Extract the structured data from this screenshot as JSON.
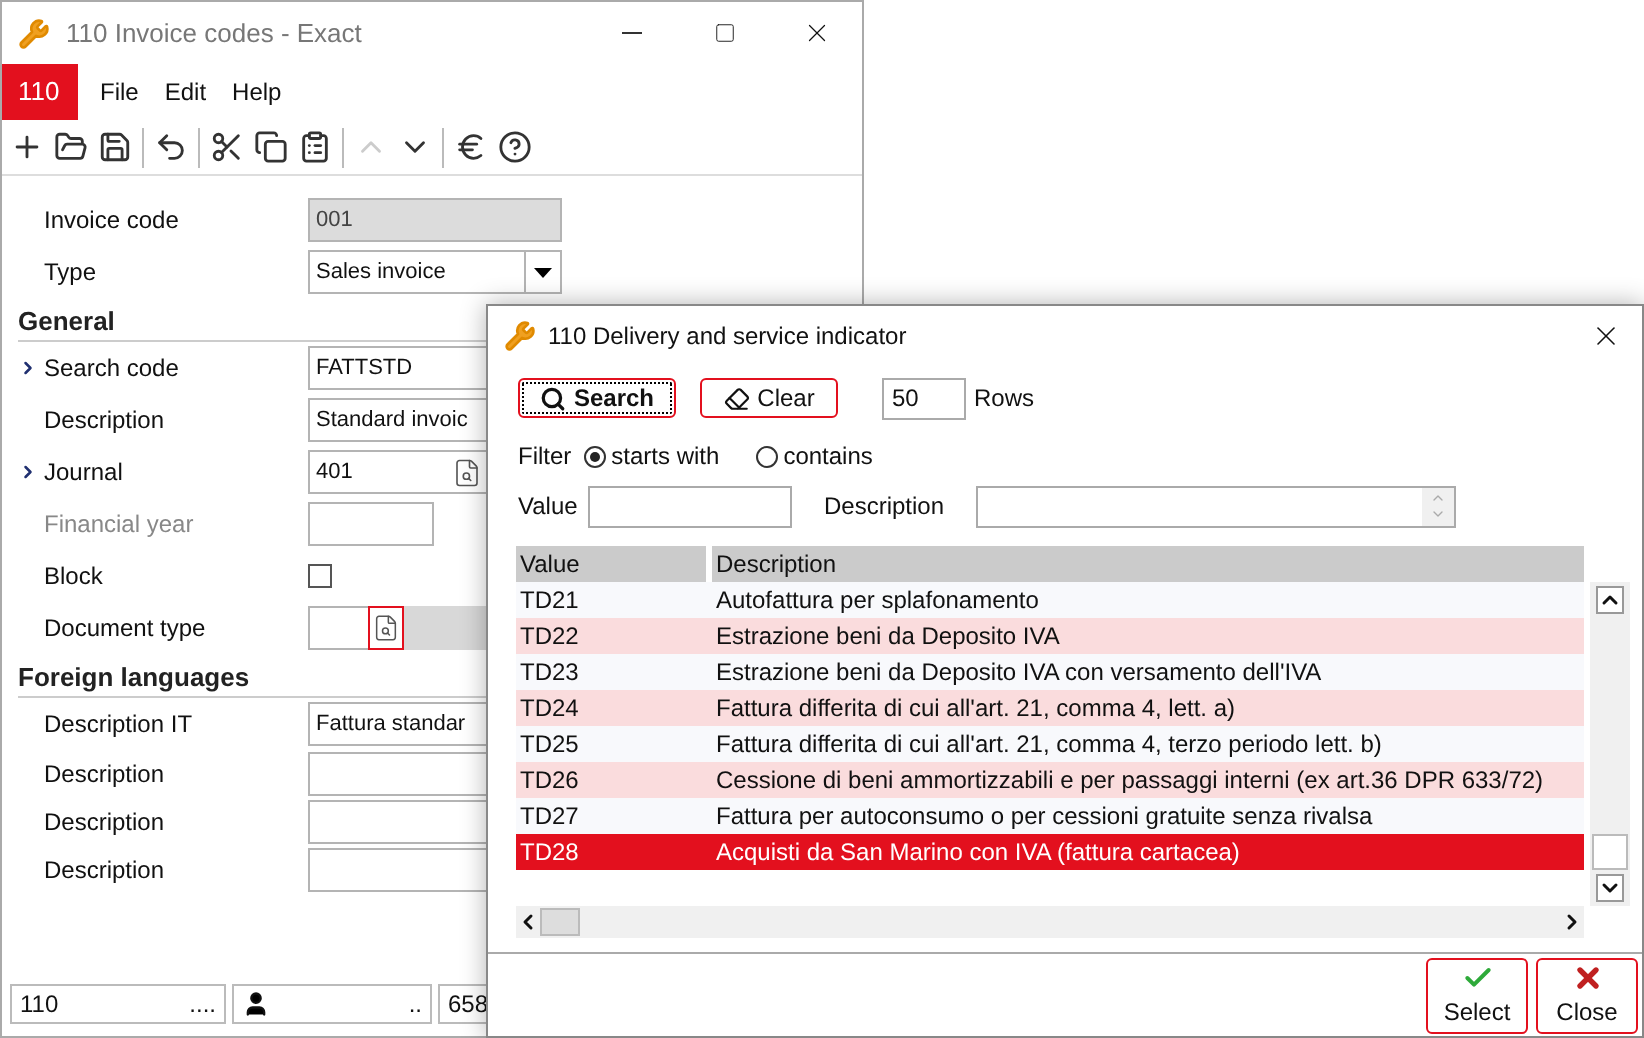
{
  "main_window": {
    "title": "110 Invoice codes - Exact",
    "badge": "110",
    "menu": [
      "File",
      "Edit",
      "Help"
    ],
    "toolbar": [
      {
        "kind": "add",
        "disabled": false
      },
      {
        "kind": "open",
        "disabled": false
      },
      {
        "kind": "save",
        "disabled": false
      },
      {
        "kind": "sep"
      },
      {
        "kind": "undo",
        "disabled": false
      },
      {
        "kind": "sep"
      },
      {
        "kind": "cut",
        "disabled": false
      },
      {
        "kind": "copy",
        "disabled": false
      },
      {
        "kind": "paste",
        "disabled": false
      },
      {
        "kind": "sep"
      },
      {
        "kind": "up",
        "disabled": true
      },
      {
        "kind": "down",
        "disabled": false
      },
      {
        "kind": "sep"
      },
      {
        "kind": "euro",
        "disabled": false
      },
      {
        "kind": "help",
        "disabled": false
      }
    ],
    "form": [
      {
        "kind": "readonly",
        "label": "Invoice code",
        "value": "001",
        "linked": false,
        "disabled": false
      },
      {
        "kind": "select",
        "label": "Type",
        "value": "Sales invoice",
        "linked": false,
        "disabled": false
      },
      {
        "kind": "section",
        "label": "General"
      },
      {
        "kind": "text",
        "label": "Search code",
        "value": "FATTSTD",
        "linked": true,
        "disabled": false
      },
      {
        "kind": "text",
        "label": "Description",
        "value": "Standard invoic",
        "linked": false,
        "disabled": false
      },
      {
        "kind": "lookup",
        "label": "Journal",
        "value": "401",
        "linked": true,
        "disabled": false
      },
      {
        "kind": "short",
        "label": "Financial year",
        "linked": false,
        "disabled": true
      },
      {
        "kind": "checkbox",
        "label": "Block",
        "checked": false,
        "linked": false,
        "disabled": false
      },
      {
        "kind": "doclookup",
        "label": "Document type",
        "linked": false,
        "disabled": false
      },
      {
        "kind": "section",
        "label": "Foreign languages"
      },
      {
        "kind": "text",
        "label": "Description IT",
        "value": "Fattura standar",
        "linked": false,
        "disabled": false
      },
      {
        "kind": "text",
        "label": "Description",
        "linked": false,
        "disabled": false
      },
      {
        "kind": "text",
        "label": "Description",
        "linked": false,
        "disabled": false
      },
      {
        "kind": "text",
        "label": "Description",
        "linked": false,
        "disabled": false
      }
    ],
    "status_bar": [
      {
        "kind": "text",
        "text": "110",
        "trail": "...."
      },
      {
        "kind": "user",
        "trail": ".."
      },
      {
        "kind": "text",
        "text": "658"
      }
    ]
  },
  "dialog": {
    "title": "110 Delivery and service indicator",
    "search_label": "Search",
    "clear_label": "Clear",
    "rows_value": "50",
    "rows_label": "Rows",
    "filter_label": "Filter",
    "filter_options": [
      {
        "label": "starts with",
        "selected": true
      },
      {
        "label": "contains",
        "selected": false
      }
    ],
    "value_label": "Value",
    "description_label": "Description",
    "columns": [
      "Value",
      "Description"
    ],
    "rows": [
      {
        "value": "TD21",
        "description": "Autofattura per splafonamento",
        "selected": false
      },
      {
        "value": "TD22",
        "description": "Estrazione beni da Deposito IVA",
        "selected": false
      },
      {
        "value": "TD23",
        "description": "Estrazione beni da Deposito IVA con versamento dell'IVA",
        "selected": false
      },
      {
        "value": "TD24",
        "description": "Fattura differita di cui all'art. 21, comma 4, lett. a)",
        "selected": false
      },
      {
        "value": "TD25",
        "description": "Fattura differita di cui all'art. 21, comma 4, terzo periodo lett. b)",
        "selected": false
      },
      {
        "value": "TD26",
        "description": "Cessione di beni ammortizzabili e per passaggi interni (ex art.36 DPR 633/72)",
        "selected": false
      },
      {
        "value": "TD27",
        "description": "Fattura per autoconsumo o per cessioni gratuite senza rivalsa",
        "selected": false
      },
      {
        "value": "TD28",
        "description": "Acquisti da San Marino con IVA (fattura cartacea)",
        "selected": true
      }
    ],
    "footer_buttons": [
      {
        "kind": "select",
        "label": "Select"
      },
      {
        "kind": "close",
        "label": "Close"
      }
    ]
  }
}
